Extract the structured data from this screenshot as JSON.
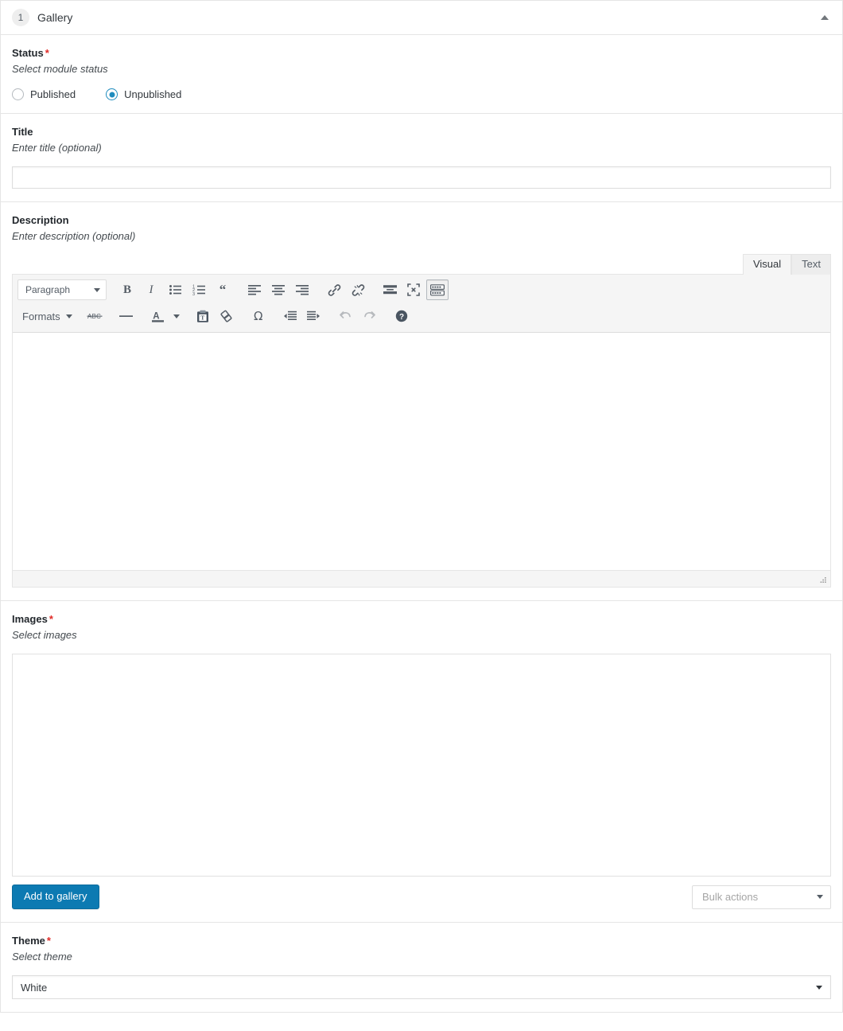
{
  "panel": {
    "number": "1",
    "title": "Gallery",
    "collapse_icon": "caret-up-icon"
  },
  "fields": {
    "status": {
      "label": "Status",
      "required": "*",
      "description": "Select module status",
      "options": [
        {
          "label": "Published",
          "selected": false
        },
        {
          "label": "Unpublished",
          "selected": true
        }
      ]
    },
    "title": {
      "label": "Title",
      "required": "",
      "description": "Enter title (optional)",
      "value": "",
      "placeholder": ""
    },
    "description": {
      "label": "Description",
      "required": "",
      "description": "Enter description (optional)",
      "value": "",
      "tabs": [
        {
          "label": "Visual",
          "active": true
        },
        {
          "label": "Text",
          "active": false
        }
      ],
      "toolbar_row1": [
        {
          "name": "paragraph-format-select",
          "type": "select",
          "label": "Paragraph"
        },
        {
          "name": "bold-icon",
          "type": "icon",
          "label": "B"
        },
        {
          "name": "italic-icon",
          "type": "icon",
          "label": "I"
        },
        {
          "name": "bullet-list-icon",
          "type": "icon",
          "label": "Bulleted list"
        },
        {
          "name": "numbered-list-icon",
          "type": "icon",
          "label": "Numbered list"
        },
        {
          "name": "blockquote-icon",
          "type": "icon",
          "label": "Blockquote"
        },
        {
          "name": "align-left-icon",
          "type": "icon",
          "label": "Align left"
        },
        {
          "name": "align-center-icon",
          "type": "icon",
          "label": "Align center"
        },
        {
          "name": "align-right-icon",
          "type": "icon",
          "label": "Align right"
        },
        {
          "name": "insert-link-icon",
          "type": "icon",
          "label": "Insert/edit link"
        },
        {
          "name": "unlink-icon",
          "type": "icon",
          "label": "Remove link"
        },
        {
          "name": "read-more-icon",
          "type": "icon",
          "label": "Insert Read More tag"
        },
        {
          "name": "fullscreen-icon",
          "type": "icon",
          "label": "Distraction-free writing mode"
        },
        {
          "name": "toolbar-toggle-icon",
          "type": "icon",
          "label": "Toolbar Toggle",
          "pressed": true
        }
      ],
      "toolbar_row2": [
        {
          "name": "formats-select",
          "type": "text-select",
          "label": "Formats"
        },
        {
          "name": "strikethrough-icon",
          "type": "icon",
          "label": "ABC"
        },
        {
          "name": "horizontal-rule-icon",
          "type": "icon",
          "label": "Horizontal line"
        },
        {
          "name": "text-color-icon",
          "type": "icon",
          "label": "Text color"
        },
        {
          "name": "paste-as-text-icon",
          "type": "icon",
          "label": "Paste as text"
        },
        {
          "name": "clear-formatting-icon",
          "type": "icon",
          "label": "Clear formatting"
        },
        {
          "name": "special-character-icon",
          "type": "icon",
          "label": "Special character"
        },
        {
          "name": "outdent-icon",
          "type": "icon",
          "label": "Decrease indent"
        },
        {
          "name": "indent-icon",
          "type": "icon",
          "label": "Increase indent"
        },
        {
          "name": "undo-icon",
          "type": "icon",
          "label": "Undo",
          "disabled": true
        },
        {
          "name": "redo-icon",
          "type": "icon",
          "label": "Redo",
          "disabled": true
        },
        {
          "name": "keyboard-shortcuts-icon",
          "type": "icon",
          "label": "Keyboard Shortcuts"
        }
      ]
    },
    "images": {
      "label": "Images",
      "required": "*",
      "description": "Select images",
      "add_button_label": "Add to gallery",
      "bulk_actions_placeholder": "Bulk actions"
    },
    "theme": {
      "label": "Theme",
      "required": "*",
      "description": "Select theme",
      "value": "White"
    }
  },
  "colors": {
    "accent_blue": "#0c7ab2",
    "radio_blue": "#1e8cbe",
    "required_red": "#e02b27",
    "border_gray": "#e5e5e5",
    "toolbar_bg": "#f5f5f5"
  }
}
